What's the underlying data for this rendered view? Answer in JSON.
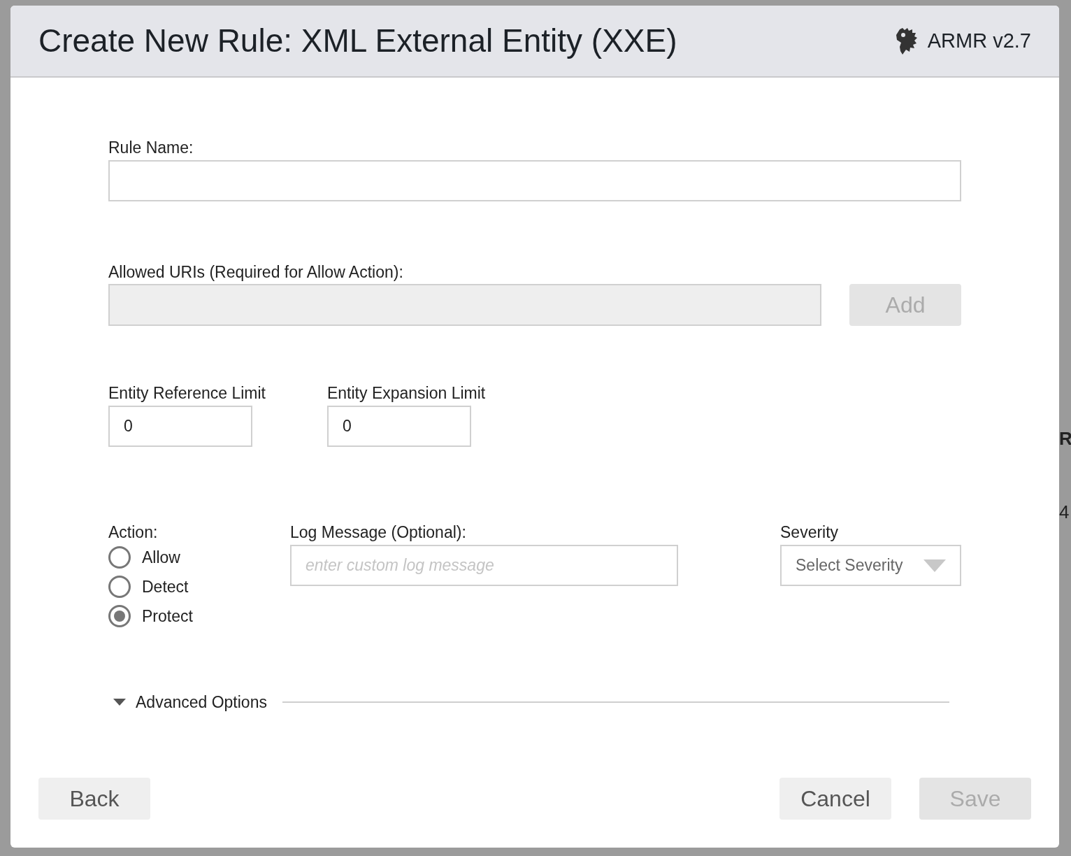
{
  "dialog": {
    "title": "Create New Rule: XML External Entity (XXE)",
    "brand": "ARMR v2.7"
  },
  "rule_name": {
    "label": "Rule Name:"
  },
  "allowed_uris": {
    "label": "Allowed URIs (Required for Allow Action):",
    "disabled": true,
    "add_button": {
      "label": "Add",
      "disabled": true
    }
  },
  "limits": [
    {
      "label": "Entity Reference Limit",
      "value": "0"
    },
    {
      "label": "Entity Expansion Limit",
      "value": "0"
    }
  ],
  "action": {
    "label": "Action:",
    "options": [
      {
        "label": "Allow",
        "selected": false
      },
      {
        "label": "Detect",
        "selected": false
      },
      {
        "label": "Protect",
        "selected": true
      }
    ]
  },
  "log_message": {
    "label": "Log Message (Optional):",
    "placeholder": "enter custom log message"
  },
  "severity": {
    "label": "Severity",
    "placeholder": "Select Severity"
  },
  "advanced_options": {
    "label": "Advanced Options",
    "expanded": false
  },
  "buttons": [
    {
      "label": "Back",
      "disabled": false
    },
    {
      "label": "Cancel",
      "disabled": false
    },
    {
      "label": "Save",
      "disabled": true
    }
  ],
  "background_fragments": [
    "R",
    "4"
  ]
}
